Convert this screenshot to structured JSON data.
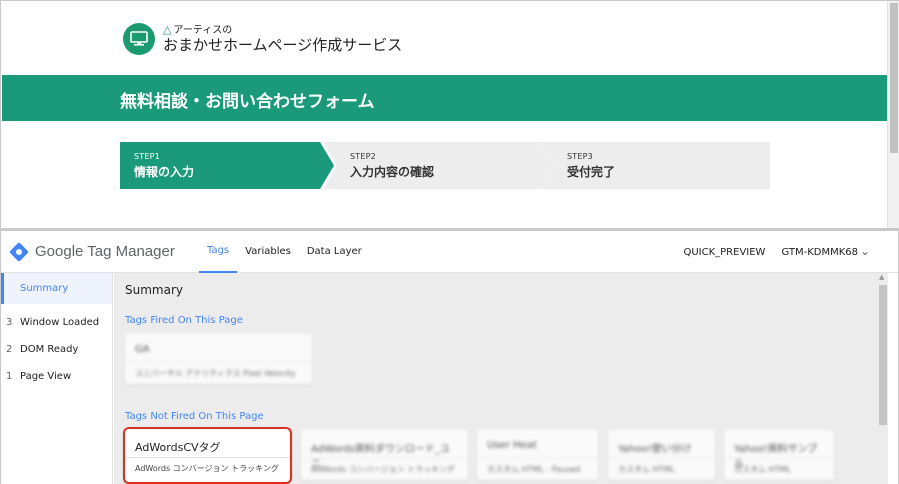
{
  "site": {
    "logo_small": "アーティスの",
    "logo_big": "おまかせホームページ作成サービス",
    "hero_title": "無料相談・お問い合わせフォーム",
    "steps": [
      {
        "num": "STEP1",
        "label": "情報の入力"
      },
      {
        "num": "STEP2",
        "label": "入力内容の確認"
      },
      {
        "num": "STEP3",
        "label": "受付完了"
      }
    ],
    "colors": {
      "brand": "#1a9a7a",
      "step_inactive": "#ededed"
    }
  },
  "gtm": {
    "title": "Google Tag Manager",
    "tabs": [
      "Tags",
      "Variables",
      "Data Layer"
    ],
    "active_tab": "Tags",
    "mode": "QUICK_PREVIEW",
    "container_id": "GTM-KDMMK68",
    "sidebar": {
      "summary": "Summary",
      "events": [
        {
          "index": "3",
          "label": "Window Loaded"
        },
        {
          "index": "2",
          "label": "DOM Ready"
        },
        {
          "index": "1",
          "label": "Page View"
        }
      ]
    },
    "main_title": "Summary",
    "fired_label": "Tags Fired On This Page",
    "not_fired_label": "Tags Not Fired On This Page",
    "fired_tags": [
      {
        "name": "GA",
        "type": "ユニバーサル アナリティクス  Pixel Velocity"
      }
    ],
    "not_fired_tags": [
      {
        "name": "AdWordsCVタグ",
        "type": "AdWords コンバージョン トラッキング",
        "highlighted": true
      },
      {
        "name": "AdWords資料ダウンロード_ユニ",
        "type": "AdWords コンバージョン トラッキング"
      },
      {
        "name": "User Heat",
        "type": "カスタム HTML - Paused"
      },
      {
        "name": "Yahoo!使い分け",
        "type": "カスタム HTML"
      },
      {
        "name": "Yahoo!資料サンプル",
        "type": "カスタム HTML"
      }
    ],
    "colors": {
      "accent": "#4285f4",
      "highlight_border": "#d93025"
    }
  }
}
